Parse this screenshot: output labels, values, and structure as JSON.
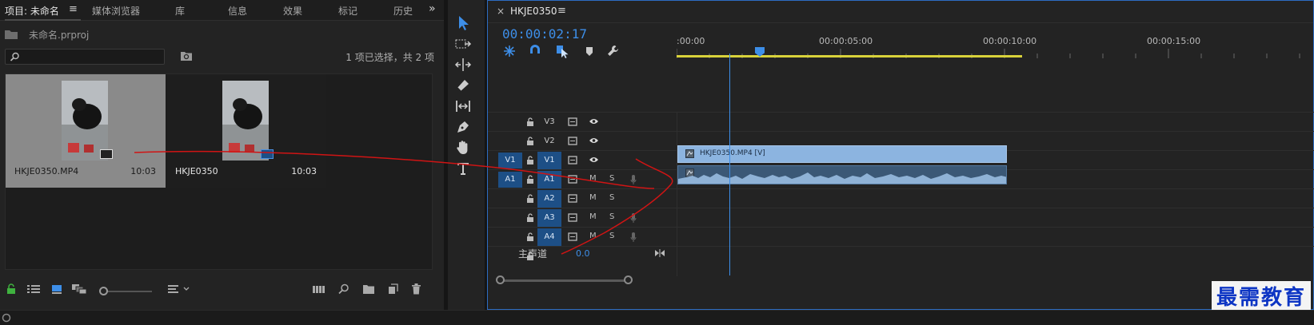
{
  "project_panel": {
    "tabs": [
      "项目: 未命名",
      "媒体浏览器",
      "库",
      "信息",
      "效果",
      "标记",
      "历史"
    ],
    "project_file": "未命名.prproj",
    "search_placeholder": "",
    "selection_status": "1 项已选择，共 2 项",
    "items": [
      {
        "name": "HKJE0350.MP4",
        "duration": "10:03",
        "selected": true
      },
      {
        "name": "HKJE0350",
        "duration": "10:03",
        "selected": false
      }
    ]
  },
  "timeline": {
    "sequence_name": "HKJE0350",
    "timecode": "00:00:02:17",
    "ruler_labels": [
      ":00:00",
      "00:00:05:00",
      "00:00:10:00",
      "00:00:15:00"
    ],
    "video_tracks": [
      {
        "source": "",
        "target": "V3",
        "target_on": false
      },
      {
        "source": "",
        "target": "V2",
        "target_on": false
      },
      {
        "source": "V1",
        "target": "V1",
        "target_on": true
      }
    ],
    "audio_tracks": [
      {
        "source": "A1",
        "target": "A1",
        "target_on": true
      },
      {
        "source": "",
        "target": "A2",
        "target_on": true
      },
      {
        "source": "",
        "target": "A3",
        "target_on": true
      },
      {
        "source": "",
        "target": "A4",
        "target_on": true
      }
    ],
    "mute_label": "M",
    "solo_label": "S",
    "video_clip_label": "HKJE0350.MP4 [V]",
    "master_label": "主声道",
    "master_value": "0.0"
  },
  "watermark": "最需教育",
  "colors": {
    "accent": "#3d8ee8",
    "work_area": "#d8d23a",
    "video_clip": "#8cb4e0",
    "audio_clip": "#3b5876",
    "annotation": "#d01414"
  }
}
